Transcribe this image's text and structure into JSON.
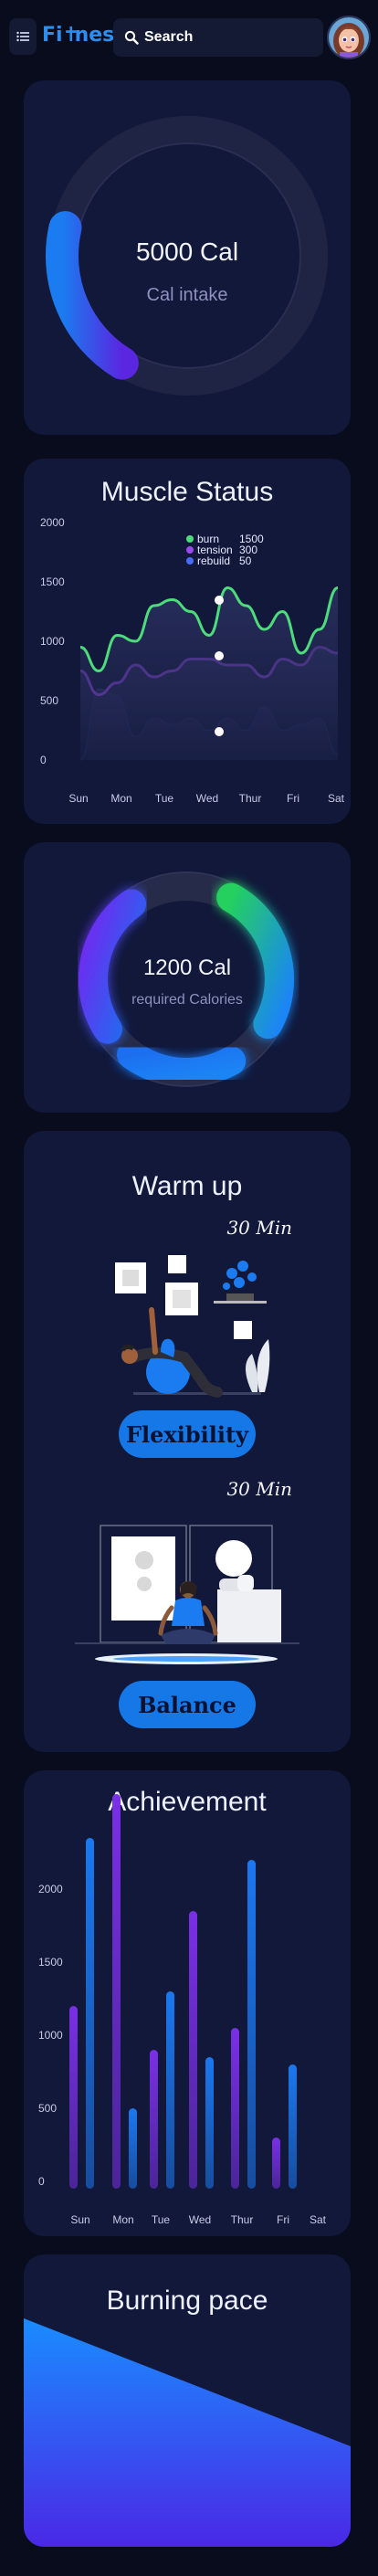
{
  "header": {
    "menu_icon": "list-icon",
    "brand_prefix": "Fi",
    "brand_suffix": "ness",
    "search_label": "Search",
    "search_icon": "search-icon",
    "avatar_icon": "user-avatar-icon"
  },
  "intake": {
    "value": "5000 Cal",
    "label": "Cal intake",
    "progress": 0.32
  },
  "muscle": {
    "title": "Muscle Status",
    "chart_data": {
      "type": "area",
      "title": "Muscle Status",
      "categories": [
        "Sun",
        "Mon",
        "Tue",
        "Wed",
        "Thur",
        "Fri",
        "Sat"
      ],
      "yticks": [
        0,
        500,
        1000,
        1500,
        2000
      ],
      "ylim": [
        0,
        2000
      ],
      "legend_position": "top",
      "series": [
        {
          "name": "burn",
          "legend_value": "1500",
          "color": "#4ddc7c",
          "values": [
            950,
            750,
            1050,
            1000,
            1300,
            1350,
            1250,
            1050,
            1450,
            1300,
            1100,
            1250,
            900,
            1100,
            1450
          ]
        },
        {
          "name": "tension",
          "legend_value": "300",
          "color": "#9b4af0",
          "values": [
            750,
            550,
            650,
            800,
            700,
            750,
            850,
            850,
            800,
            800,
            700,
            850,
            800,
            950,
            900
          ]
        },
        {
          "name": "rebuild",
          "legend_value": "50",
          "color": "#4a6bfa",
          "values": [
            0,
            600,
            550,
            200,
            350,
            300,
            350,
            250,
            350,
            250,
            450,
            250,
            300,
            350,
            50
          ]
        }
      ]
    }
  },
  "required": {
    "value": "1200 Cal",
    "label": "required Calories",
    "segments": [
      {
        "color_a": "#6f2af0",
        "color_b": "#1d6ff0",
        "from": 0.66,
        "to": 0.9
      },
      {
        "color_a": "#1d6ff0",
        "color_b": "#1a85f5",
        "from": 0.42,
        "to": 0.6
      },
      {
        "color_a": "#25d05f",
        "color_b": "#1a85f5",
        "from": 0.08,
        "to": 0.33
      }
    ]
  },
  "warmup": {
    "title": "Warm up",
    "exercises": [
      {
        "duration": "30 Min",
        "label": "Flexibility"
      },
      {
        "duration": "30 Min",
        "label": "Balance"
      }
    ]
  },
  "achievement": {
    "title": "Achievement",
    "chart_data": {
      "type": "bar",
      "title": "Achievement",
      "categories": [
        "Sun",
        "Mon",
        "Tue",
        "Wed",
        "Thur",
        "Fri",
        "Sat"
      ],
      "yticks": [
        0,
        500,
        1000,
        1500,
        2000
      ],
      "ylim": [
        0,
        2000
      ],
      "series": [
        {
          "name": "",
          "color": "#7a2fe6",
          "values": [
            1200,
            2650,
            900,
            1850,
            1050,
            300,
            0
          ]
        },
        {
          "name": "",
          "color": "#1b78f0",
          "values": [
            2350,
            500,
            1300,
            850,
            2200,
            800,
            0
          ]
        }
      ]
    }
  },
  "pace": {
    "title": "Burning pace",
    "chart_data": {
      "type": "area",
      "title": "Burning pace",
      "values": [
        1.0,
        0.44
      ]
    }
  },
  "colors": {
    "accent": "#1677e6",
    "card": "#11183a",
    "page": "#080c1d"
  }
}
